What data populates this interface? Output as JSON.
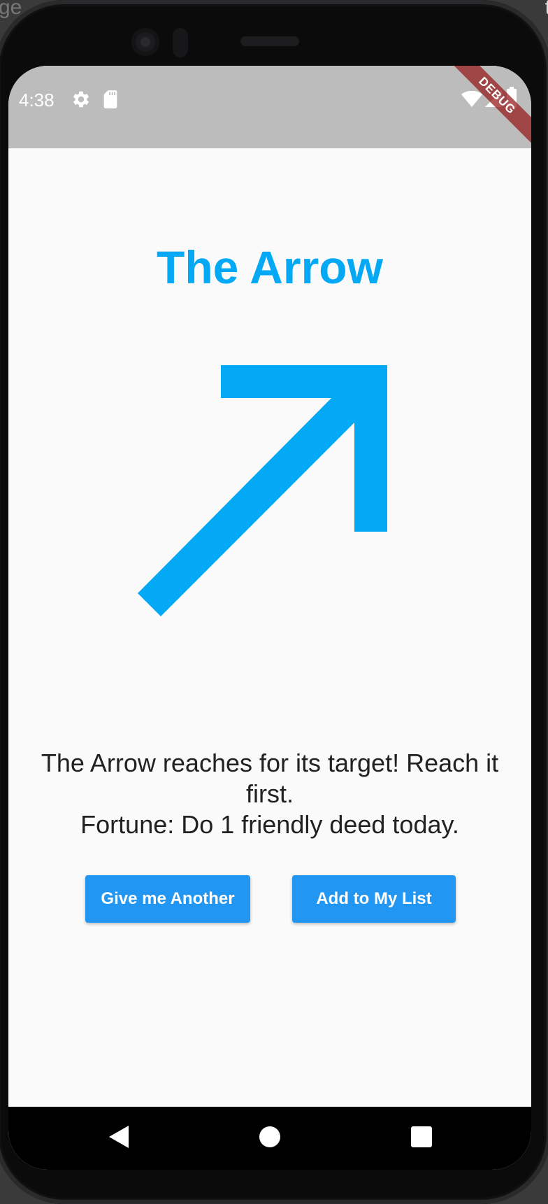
{
  "background": {
    "left_text": "ge",
    "right_text": "t"
  },
  "status_bar": {
    "time": "4:38",
    "icons": [
      "gear-icon",
      "sd-card-icon",
      "wifi-icon",
      "signal-icon",
      "battery-icon"
    ],
    "debug_banner": "DEBUG"
  },
  "app": {
    "title": "The Arrow",
    "image_icon": "north-east-arrow-icon",
    "message_lines": [
      "The Arrow reaches for its target! Reach it first.",
      "Fortune: Do 1 friendly deed today."
    ],
    "buttons": {
      "another_label": "Give me Another",
      "add_label": "Add to My List"
    }
  },
  "nav_bar": {
    "items": [
      "back-icon",
      "home-icon",
      "recents-icon"
    ]
  },
  "colors": {
    "title": "#03a9f4",
    "arrow": "#03a9f4",
    "button": "#2196f3",
    "status_bar": "#bcbcbc",
    "screen_bg": "#fafafa",
    "debug_banner": "#961e1e"
  }
}
